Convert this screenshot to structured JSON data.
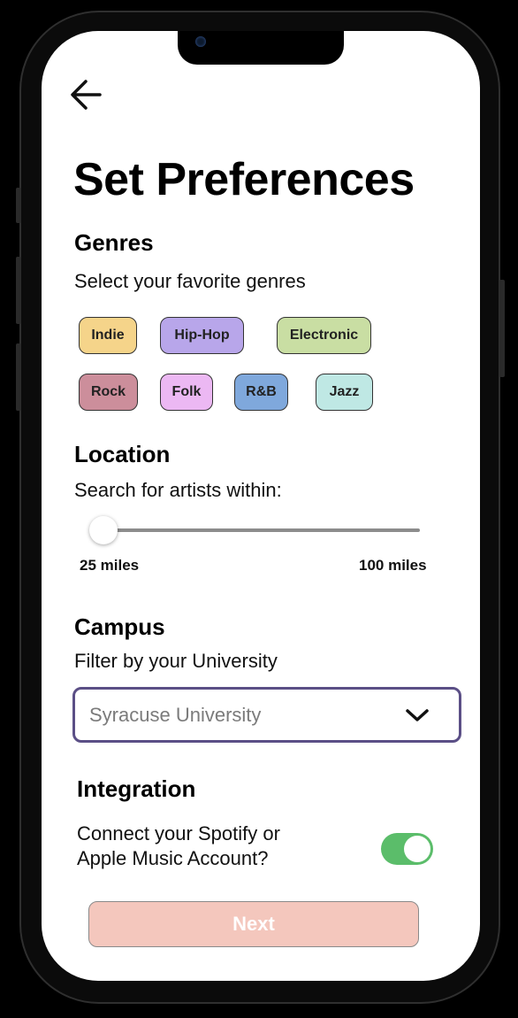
{
  "page": {
    "title": "Set Preferences"
  },
  "genres": {
    "heading": "Genres",
    "subtitle": "Select your favorite genres",
    "chips": [
      {
        "label": "Indie",
        "color": "#f5d48a"
      },
      {
        "label": "Hip-Hop",
        "color": "#b8a6ea"
      },
      {
        "label": "Electronic",
        "color": "#c9dea3"
      },
      {
        "label": "Rock",
        "color": "#cc8e9b"
      },
      {
        "label": "Folk",
        "color": "#ecb8f3"
      },
      {
        "label": "R&B",
        "color": "#7fa8dc"
      },
      {
        "label": "Jazz",
        "color": "#bfe8e4"
      }
    ]
  },
  "location": {
    "heading": "Location",
    "subtitle": "Search for artists within:",
    "slider": {
      "min_label": "25 miles",
      "max_label": "100 miles",
      "value_fraction": 0
    }
  },
  "campus": {
    "heading": "Campus",
    "subtitle": "Filter by your University",
    "selected": "Syracuse University",
    "border_color": "#5b4f86"
  },
  "integration": {
    "heading": "Integration",
    "question_line1": "Connect your Spotify or",
    "question_line2": "Apple Music Account?",
    "toggle_on": true,
    "toggle_color": "#5bbd6a"
  },
  "footer": {
    "next_label": "Next",
    "next_color": "#f4c7bd"
  },
  "icons": {
    "back": "arrow-left-icon",
    "dropdown": "chevron-down-icon"
  }
}
